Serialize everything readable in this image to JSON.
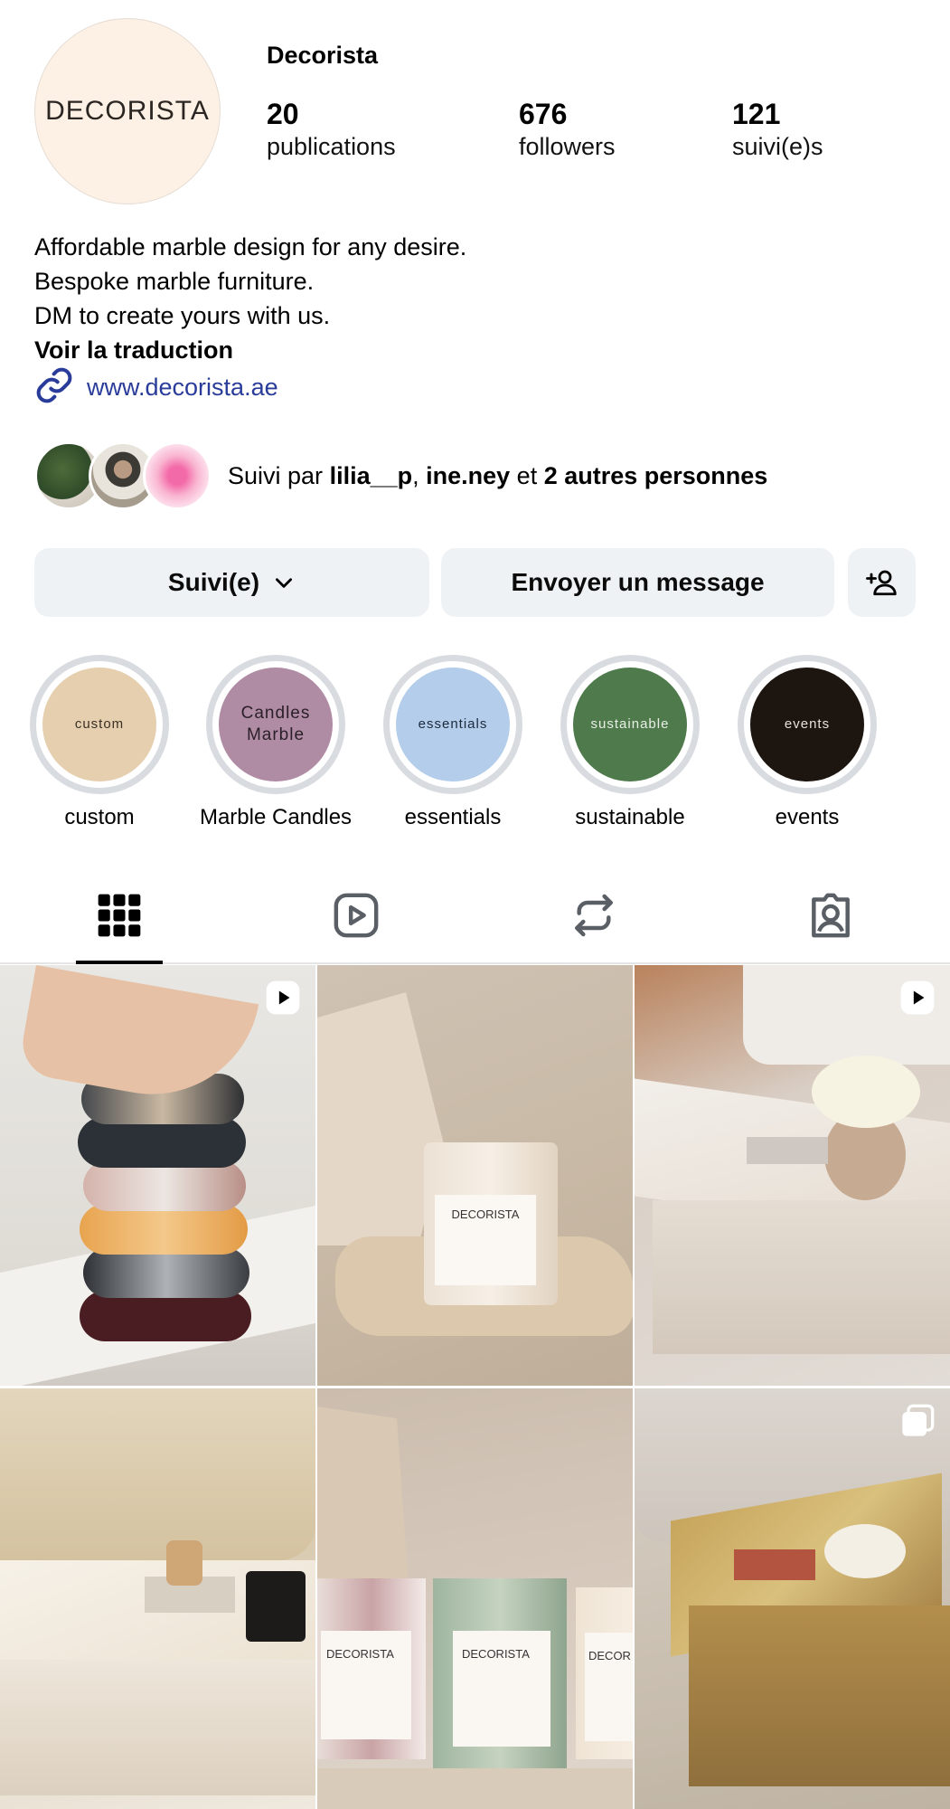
{
  "profile": {
    "avatar_text": "DECORISTA",
    "username": "Decorista",
    "stats": [
      {
        "value": "20",
        "label": "publications"
      },
      {
        "value": "676",
        "label": "followers"
      },
      {
        "value": "121",
        "label": "suivi(e)s"
      }
    ]
  },
  "bio": {
    "lines": [
      "Affordable marble design for any desire.",
      "Bespoke marble furniture.",
      "DM to create yours with us."
    ],
    "translate": "Voir la traduction",
    "link": "www.decorista.ae"
  },
  "mutual": {
    "prefix": "Suivi par ",
    "user1": "lilia__p",
    "sep": ", ",
    "user2": "ine.ney",
    "mid": " et ",
    "others": "2 autres personnes"
  },
  "buttons": {
    "follow": "Suivi(e)",
    "message": "Envoyer un message"
  },
  "highlights": [
    {
      "inner1": "custom",
      "inner2": "",
      "caption": "custom",
      "color": "#e5cfae",
      "text_color": "#3a3026"
    },
    {
      "inner1": "Candles",
      "inner2": "Marble",
      "caption": "Marble Candles",
      "color": "#b08ca4",
      "text_color": "#2a1f28"
    },
    {
      "inner1": "essentials",
      "inner2": "",
      "caption": "essentials",
      "color": "#b4cdea",
      "text_color": "#1d2a3c"
    },
    {
      "inner1": "sustainable",
      "inner2": "",
      "caption": "sustainable",
      "color": "#4f7a4c",
      "text_color": "#e9efe6"
    },
    {
      "inner1": "events",
      "inner2": "",
      "caption": "events",
      "color": "#1d1510",
      "text_color": "#e9e2db"
    }
  ],
  "tabs": [
    "grid",
    "reels",
    "reposts",
    "tagged"
  ],
  "posts": [
    {
      "type": "reel"
    },
    {
      "type": "photo",
      "label": "DECORISTA"
    },
    {
      "type": "reel"
    },
    {
      "type": "photo"
    },
    {
      "type": "photo",
      "label1": "DECORISTA",
      "label2": "DECORISTA",
      "label3": "DECOR"
    },
    {
      "type": "carousel"
    }
  ],
  "colors": {
    "link": "#2a3c9a",
    "button_bg": "#eff2f5",
    "ring": "#d8dbe0"
  },
  "icons": [
    "link-icon",
    "chevron-down-icon",
    "add-person-icon",
    "grid-icon",
    "reels-icon",
    "reposts-icon",
    "tagged-icon",
    "reel-badge-icon",
    "carousel-badge-icon"
  ]
}
